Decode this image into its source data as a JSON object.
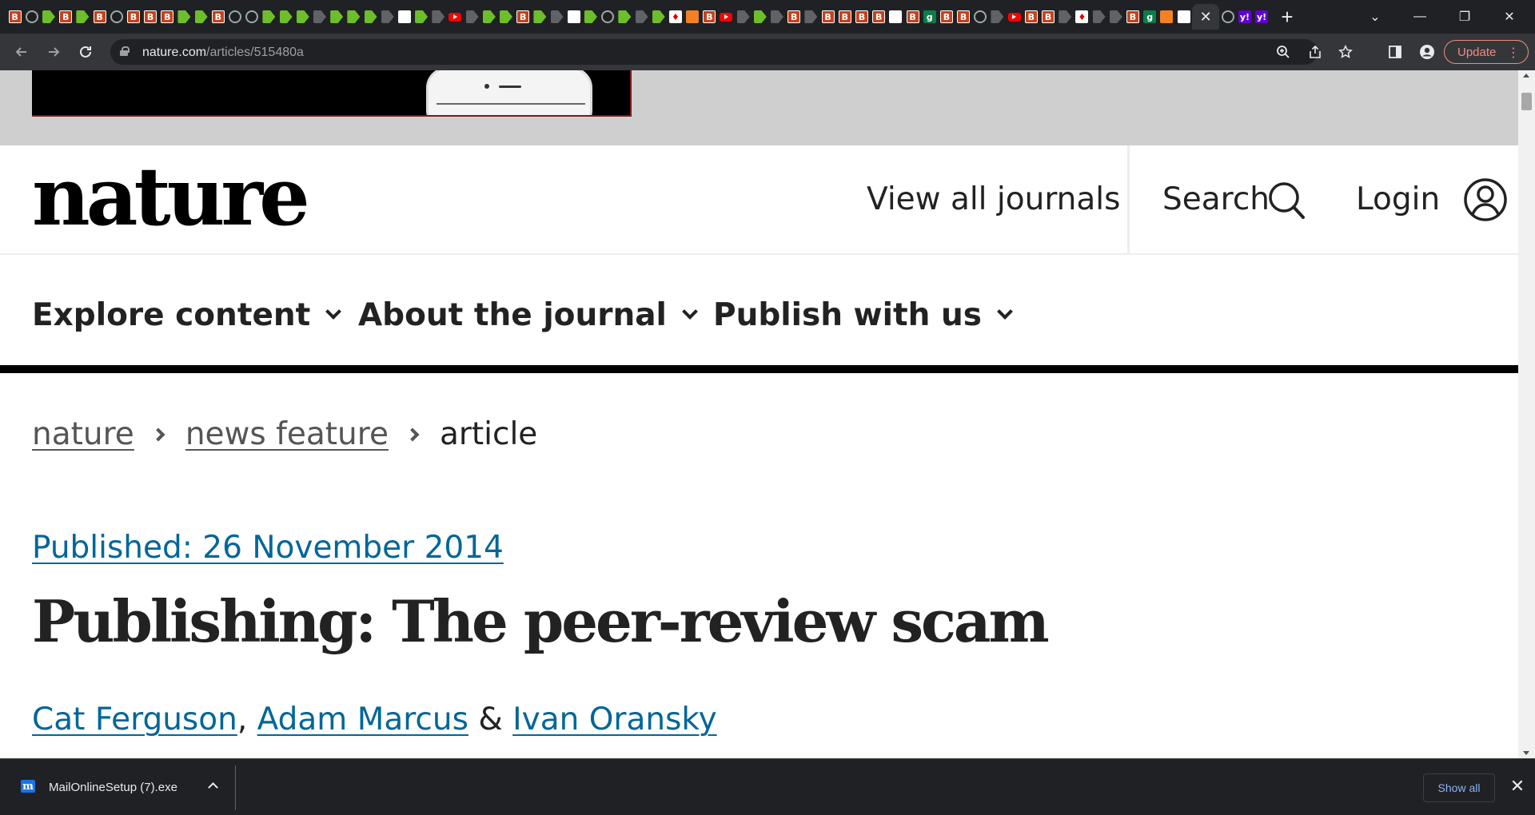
{
  "browser": {
    "tabs": [
      "B",
      "G",
      "D",
      "B",
      "D",
      "B",
      "G",
      "B",
      "B",
      "B",
      "D",
      "D",
      "B",
      "G",
      "G",
      "D",
      "D",
      "D",
      "Dg",
      "D",
      "D",
      "D",
      "Dg",
      "N",
      "D",
      "Dg",
      "Y",
      "Dg",
      "D",
      "D",
      "B",
      "D",
      "Dg",
      "W",
      "D",
      "G",
      "D",
      "Dg",
      "D",
      "R",
      "S",
      "B",
      "Y",
      "Dg",
      "D",
      "Dg",
      "B",
      "Dg",
      "B",
      "B",
      "B",
      "B",
      "W",
      "B",
      "Q",
      "B",
      "B",
      "G",
      "Dg",
      "Y",
      "B",
      "B",
      "Dg",
      "R",
      "Dg",
      "Dg",
      "B",
      "Q",
      "S",
      "W"
    ],
    "active_tab_close": "✕",
    "extra_tabs": [
      "G",
      "Yh",
      "Yh"
    ],
    "new_tab": "+",
    "window_controls": {
      "tab_search": "⌄",
      "minimize": "—",
      "restore": "❐",
      "close": "✕"
    },
    "url_host": "nature.com",
    "url_path": "/articles/515480a",
    "update_label": "Update",
    "menu_dots": "⋮"
  },
  "site": {
    "logo": "nature",
    "view_all_journals": "View all journals",
    "search_label": "Search",
    "login_label": "Login",
    "nav": {
      "explore": "Explore content",
      "about": "About the journal",
      "publish": "Publish with us"
    }
  },
  "breadcrumb": {
    "home": "nature",
    "section": "news feature",
    "current": "article"
  },
  "article": {
    "published": "Published: 26 November 2014",
    "title": "Publishing: The peer-review scam",
    "authors": [
      "Cat Ferguson",
      "Adam Marcus",
      "Ivan Oransky"
    ],
    "sep_comma": ",",
    "sep_amp": "&"
  },
  "downloads": {
    "file_name": "MailOnlineSetup (7).exe",
    "icon_letter": "m",
    "show_all": "Show all",
    "close": "✕"
  },
  "colors": {
    "link_blue": "#006699",
    "chrome_dark": "#202124",
    "update_accent": "#f28b82"
  }
}
